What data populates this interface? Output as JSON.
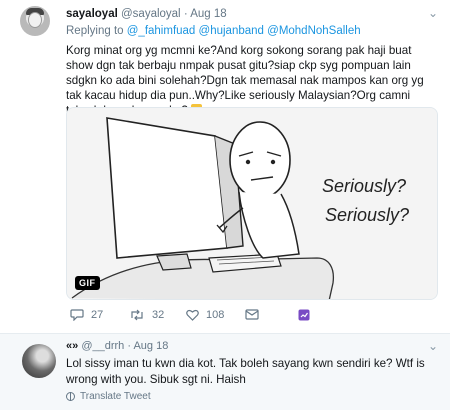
{
  "tweet": {
    "display_name": "sayaloyal",
    "handle": "@sayaloyal",
    "separator": "·",
    "date": "Aug 18",
    "replying_prefix": "Replying to",
    "replying_to": [
      "@_fahimfuad",
      "@hujanband",
      "@MohdNohSalleh"
    ],
    "text": "Korg minat org yg mcmni ke?And korg sokong sorang pak haji buat show dgn tak berbaju nmpak pusat gitu?siap ckp syg pompuan lain sdgkn ko ada bini solehah?Dgn tak memasal nak mampos kan org yg tak kacau hidup dia pun..Why?Like seriously Malaysian?Org camni takyah  kena kecam ke?",
    "media": {
      "badge": "GIF",
      "caption_line1": "Seriously?",
      "caption_line2": "Seriously?"
    },
    "actions": {
      "reply_count": "27",
      "retweet_count": "32",
      "like_count": "108"
    }
  },
  "reply": {
    "display_name": "«»",
    "handle": "@__drrh",
    "separator": "·",
    "date": "Aug 18",
    "text": "Lol sissy iman tu kwn dia kot. Tak boleh sayang kwn sendiri ke? Wtf is wrong with you. Sibuk sgt ni. Haish",
    "translate_label": "Translate Tweet"
  },
  "colors": {
    "link": "#1b95e0",
    "muted": "#657786",
    "analytics": "#794bc4",
    "reply_bg": "#f5f8fa"
  }
}
